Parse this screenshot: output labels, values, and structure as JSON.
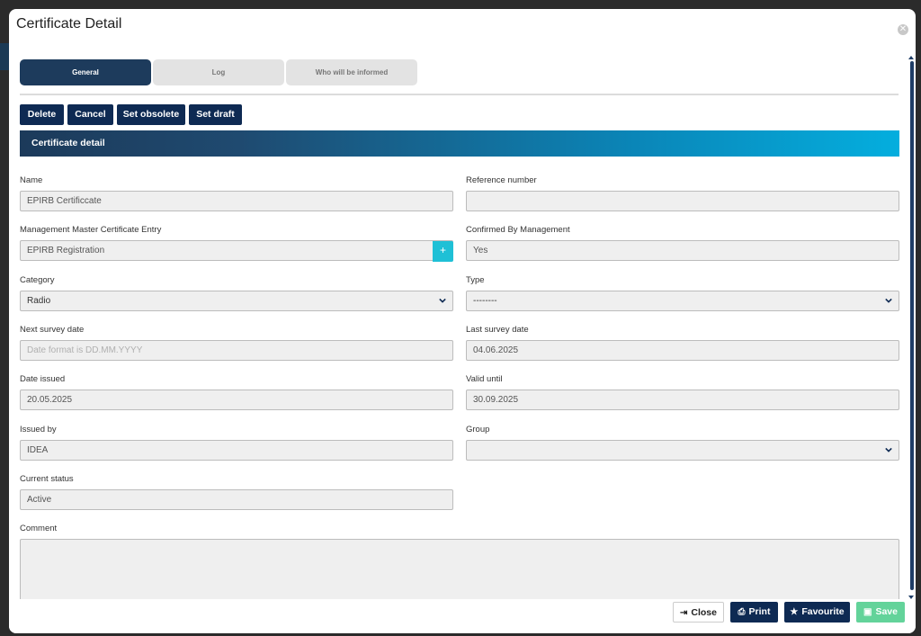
{
  "modal": {
    "title": "Certificate Detail",
    "close_icon": "close-circle-icon"
  },
  "tabs": [
    {
      "label": "General",
      "active": true
    },
    {
      "label": "Log",
      "active": false
    },
    {
      "label": "Who will be informed",
      "active": false
    }
  ],
  "actions": {
    "delete": "Delete",
    "cancel": "Cancel",
    "set_obsolete": "Set obsolete",
    "set_draft": "Set draft"
  },
  "section": {
    "title": "Certificate detail"
  },
  "fields": {
    "name": {
      "label": "Name",
      "value": "EPIRB Certificcate"
    },
    "reference_number": {
      "label": "Reference number",
      "value": ""
    },
    "management_master": {
      "label": "Management Master Certificate Entry",
      "value": "EPIRB Registration"
    },
    "confirmed_by_management": {
      "label": "Confirmed By Management",
      "value": "Yes"
    },
    "category": {
      "label": "Category",
      "value": "Radio"
    },
    "type": {
      "label": "Type",
      "value": "--------"
    },
    "next_survey_date": {
      "label": "Next survey date",
      "placeholder": "Date format is DD.MM.YYYY"
    },
    "last_survey_date": {
      "label": "Last survey date",
      "value": "04.06.2025"
    },
    "date_issued": {
      "label": "Date issued",
      "value": "20.05.2025"
    },
    "valid_until": {
      "label": "Valid until",
      "value": "30.09.2025"
    },
    "issued_by": {
      "label": "Issued by",
      "value": "IDEA"
    },
    "group": {
      "label": "Group",
      "value": ""
    },
    "current_status": {
      "label": "Current status",
      "value": "Active"
    },
    "comment": {
      "label": "Comment",
      "value": ""
    }
  },
  "footer": {
    "close": "Close",
    "print": "Print",
    "favourite": "Favourite",
    "save": "Save"
  },
  "colors": {
    "primary_dark": "#0e2a53",
    "accent_cyan": "#1fc0d6",
    "save_green": "#63d39a"
  }
}
